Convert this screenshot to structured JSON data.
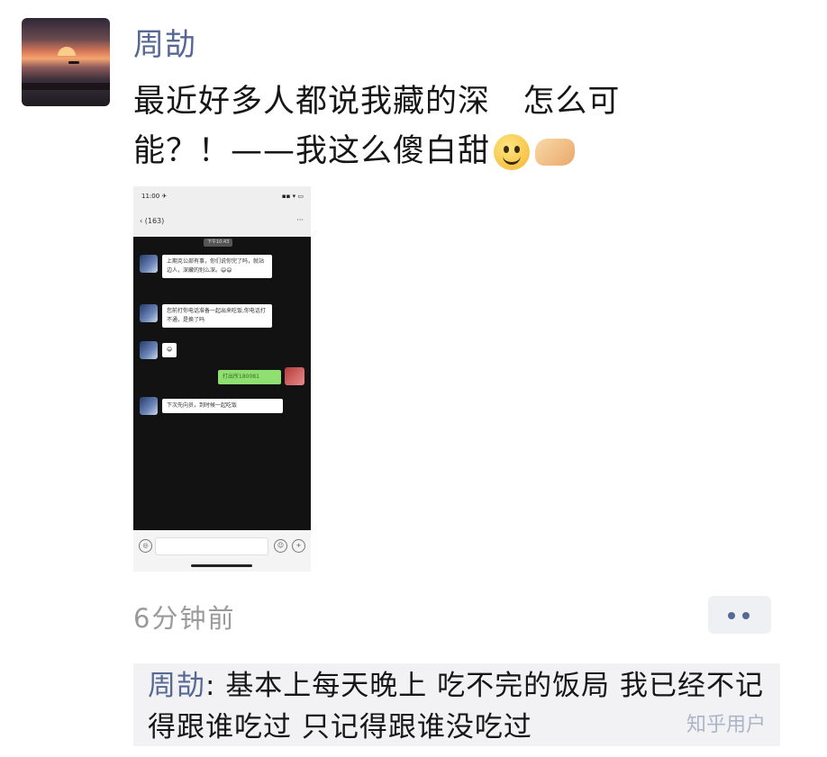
{
  "post": {
    "author": "周劼",
    "text": "最近好多人都说我藏的深   怎么可\n能？！——我这么傻白甜",
    "emojis": [
      "smile-icon",
      "handshake-icon"
    ],
    "timestamp": "6分钟前"
  },
  "screenshot": {
    "status_time": "11:00 ✈",
    "status_signal": "▪▪ ▾ ▭",
    "back_label": "‹ (163)",
    "more_label": "···",
    "time_chip": "下午10:43",
    "messages": [
      {
        "from": "other",
        "text": "上期克公部有事，你们说你完了吗，就站边人，深藏的别么深。😄😄"
      },
      {
        "from": "other",
        "text": "您前打你电话准备一起出来吃饭,你电话打不通，是换了吗"
      },
      {
        "from": "other",
        "text": "😄"
      },
      {
        "from": "self",
        "text": "打出所180081"
      },
      {
        "from": "other",
        "text": "下次先向员，到时候一起吃饭"
      }
    ]
  },
  "comment": {
    "author": "周劼",
    "separator": ": ",
    "text": "基本上每天晚上 吃不完的饭局   我已经不记得跟谁吃过  只记得跟谁没吃过"
  },
  "watermark": "知乎用户"
}
